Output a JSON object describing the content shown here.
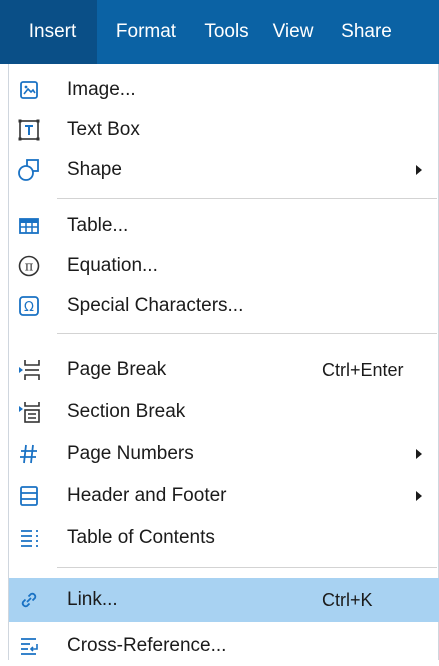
{
  "menubar": {
    "items": [
      "Insert",
      "Format",
      "Tools",
      "View",
      "Share"
    ],
    "active": "Insert"
  },
  "menu": {
    "image": {
      "label": "Image...",
      "icon": "image-icon"
    },
    "text_box": {
      "label": "Text Box",
      "icon": "text-box-icon"
    },
    "shape": {
      "label": "Shape",
      "icon": "shape-icon",
      "submenu": true
    },
    "table": {
      "label": "Table...",
      "icon": "table-icon"
    },
    "equation": {
      "label": "Equation...",
      "icon": "pi-icon"
    },
    "special_chars": {
      "label": "Special Characters...",
      "icon": "omega-icon"
    },
    "page_break": {
      "label": "Page Break",
      "shortcut": "Ctrl+Enter",
      "icon": "page-break-icon"
    },
    "section_break": {
      "label": "Section Break",
      "icon": "section-break-icon"
    },
    "page_numbers": {
      "label": "Page Numbers",
      "icon": "hash-icon",
      "submenu": true
    },
    "header_footer": {
      "label": "Header and Footer",
      "icon": "header-footer-icon",
      "submenu": true
    },
    "toc": {
      "label": "Table of Contents",
      "icon": "toc-icon"
    },
    "link": {
      "label": "Link...",
      "shortcut": "Ctrl+K",
      "icon": "link-icon",
      "highlighted": true
    },
    "cross_ref": {
      "label": "Cross-Reference...",
      "icon": "cross-reference-icon"
    }
  },
  "colors": {
    "menubar_bg": "#0b62a4",
    "active_tab_bg": "#0a4f87",
    "highlight_bg": "#a8d2f2",
    "icon_blue": "#1a72c4"
  }
}
